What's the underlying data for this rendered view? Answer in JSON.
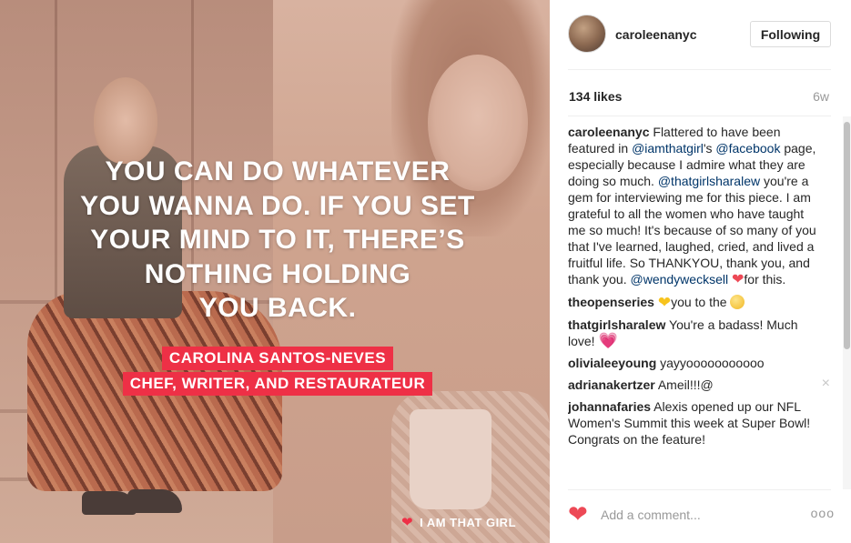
{
  "photo": {
    "quote_lines": [
      "YOU CAN DO WHATEVER",
      "YOU WANNA DO. IF YOU SET",
      "YOUR MIND TO IT, THERE’S",
      "NOTHING HOLDING",
      "YOU BACK."
    ],
    "credit_name": "CAROLINA SANTOS-NEVES",
    "credit_title": "CHEF, WRITER, AND RESTAURATEUR",
    "brand_text": "I AM THAT GIRL",
    "brand_icon": "heart-icon",
    "accent_color": "#ee3046"
  },
  "post": {
    "username": "caroleenanyc",
    "follow_label": "Following",
    "likes": "134 likes",
    "age": "6w"
  },
  "caption": {
    "user": "caroleenanyc",
    "t1": " Flattered to have been featured in ",
    "m1": "@iamthatgirl",
    "t2": "'s ",
    "m2": "@facebook",
    "t3": " page, especially because I admire what they are doing so much. ",
    "m3": "@thatgirlsharalew",
    "t4": " you're a gem for interviewing me for this piece. I am grateful to all the women who have taught me so much! It's because of so many of you that I've learned, laughed, cried, and lived a fruitful life. So THANKYOU, thank you, and thank you. ",
    "m4": "@wendywecksell",
    "t5": "for this."
  },
  "comments": [
    {
      "user": "theopenseries",
      "pre": "",
      "post1": "you to the ",
      "icons": [
        "yellow-heart-icon",
        "smiley-icon"
      ]
    },
    {
      "user": "thatgirlsharalew",
      "text": " You're a badass! Much love! ",
      "icons": [
        "pink-heart-icon"
      ]
    },
    {
      "user": "olivialeeyoung",
      "text": " yayyooooooooooo"
    },
    {
      "user": "adrianakertzer",
      "text": " Ameil!!!@",
      "remove": "×"
    },
    {
      "user": "johannafaries",
      "text": " Alexis opened up our NFL Women's Summit this week at Super Bowl! Congrats on the feature!"
    }
  ],
  "footer": {
    "comment_placeholder": "Add a comment...",
    "more": "ooo",
    "like_color": "#ed4956"
  }
}
